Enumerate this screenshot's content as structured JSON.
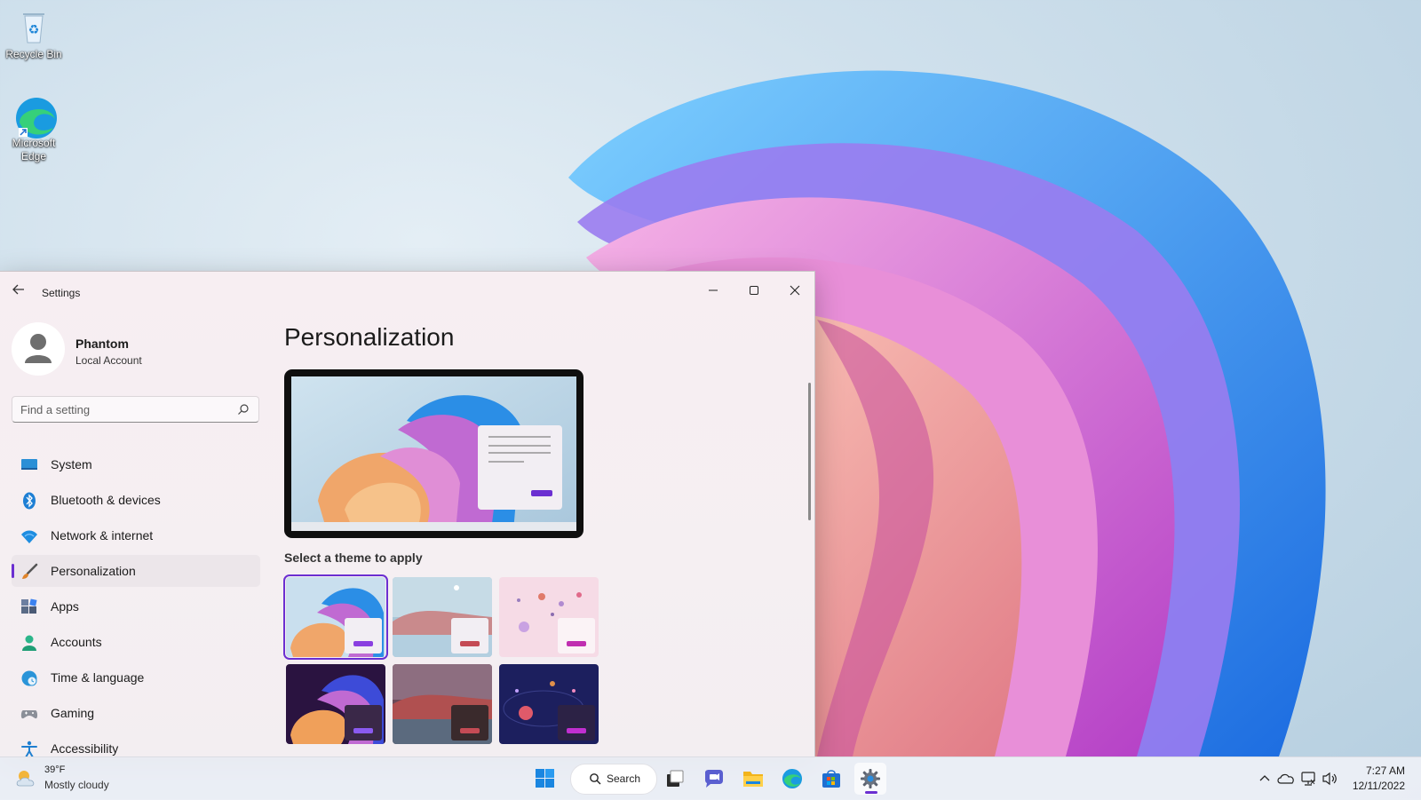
{
  "desktop": {
    "icons": [
      {
        "label": "Recycle Bin"
      },
      {
        "label": "Microsoft Edge"
      }
    ]
  },
  "window": {
    "title": "Settings",
    "controls": {
      "minimize": "—",
      "maximize": "☐",
      "close": "✕"
    }
  },
  "profile": {
    "name": "Phantom",
    "account_type": "Local Account"
  },
  "search": {
    "placeholder": "Find a setting"
  },
  "sidebar": {
    "items": [
      {
        "label": "System",
        "icon": "system-icon"
      },
      {
        "label": "Bluetooth & devices",
        "icon": "bluetooth-icon"
      },
      {
        "label": "Network & internet",
        "icon": "wifi-icon"
      },
      {
        "label": "Personalization",
        "icon": "brush-icon",
        "active": true
      },
      {
        "label": "Apps",
        "icon": "apps-icon"
      },
      {
        "label": "Accounts",
        "icon": "accounts-icon"
      },
      {
        "label": "Time & language",
        "icon": "globe-clock-icon"
      },
      {
        "label": "Gaming",
        "icon": "controller-icon"
      },
      {
        "label": "Accessibility",
        "icon": "accessibility-icon"
      }
    ]
  },
  "main": {
    "title": "Personalization",
    "select_theme_label": "Select a theme to apply",
    "themes": [
      {
        "name": "windows-light",
        "selected": true
      },
      {
        "name": "glow"
      },
      {
        "name": "captured-motion"
      },
      {
        "name": "windows-dark"
      },
      {
        "name": "sunrise"
      },
      {
        "name": "flow"
      }
    ]
  },
  "taskbar": {
    "weather": {
      "temp": "39°F",
      "desc": "Mostly cloudy"
    },
    "search_label": "Search",
    "clock": {
      "time": "7:27 AM",
      "date": "12/11/2022"
    }
  },
  "colors": {
    "accent": "#6b2fd1"
  }
}
